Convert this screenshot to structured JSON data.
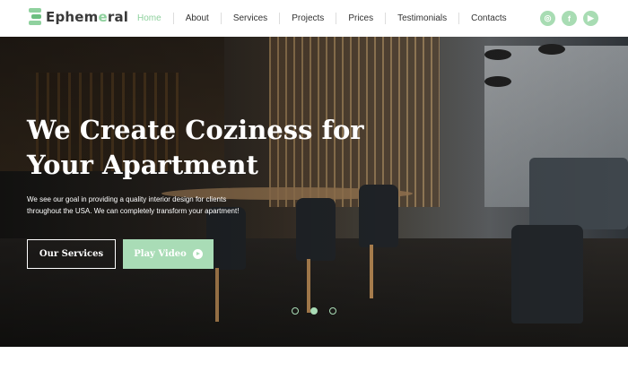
{
  "brand": {
    "name_prefix": "Ephem",
    "name_accent": "e",
    "name_suffix": "ral"
  },
  "nav": {
    "items": [
      {
        "label": "Home"
      },
      {
        "label": "About"
      },
      {
        "label": "Services"
      },
      {
        "label": "Projects"
      },
      {
        "label": "Prices"
      },
      {
        "label": "Testimonials"
      },
      {
        "label": "Contacts"
      }
    ],
    "active_index": 0
  },
  "socials": [
    {
      "icon": "instagram-icon",
      "glyph": "◎"
    },
    {
      "icon": "facebook-icon",
      "glyph": "f"
    },
    {
      "icon": "youtube-icon",
      "glyph": "▶"
    }
  ],
  "hero": {
    "title_line1": "We Create Coziness for",
    "title_line2": "Your Apartment",
    "description": "We see our goal in providing a quality interior design for clients throughout the USA. We can completely transform your apartment!",
    "primary_button": "Our Services",
    "secondary_button": "Play Video",
    "slides_count": 3,
    "active_slide": 1
  },
  "colors": {
    "accent": "#a9dcb6",
    "text_dark": "#333333"
  }
}
